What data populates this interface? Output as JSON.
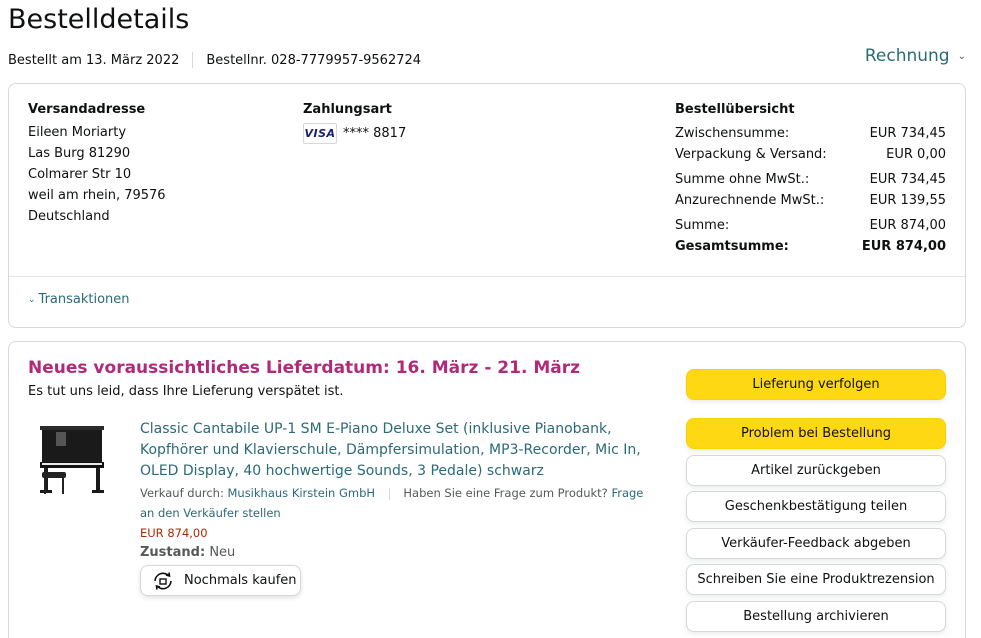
{
  "header": {
    "title": "Bestelldetails",
    "ordered_on": "Bestellt am 13. März 2022",
    "order_number": "Bestellnr. 028-7779957-9562724",
    "invoice_label": "Rechnung"
  },
  "shipping": {
    "title": "Versandadresse",
    "lines": [
      "Eileen Moriarty",
      "Las Burg 81290",
      "Colmarer Str 10",
      "weil am rhein, 79576",
      "Deutschland"
    ]
  },
  "payment": {
    "title": "Zahlungsart",
    "card_brand": "VISA",
    "card_number": "**** 8817"
  },
  "summary": {
    "title": "Bestellübersicht",
    "rows": [
      {
        "label": "Zwischensumme:",
        "value": "EUR 734,45"
      },
      {
        "label": "Verpackung & Versand:",
        "value": "EUR 0,00"
      },
      {
        "label": "Summe ohne MwSt.:",
        "value": "EUR 734,45"
      },
      {
        "label": "Anzurechnende MwSt.:",
        "value": "EUR 139,55"
      },
      {
        "label": "Summe:",
        "value": "EUR 874,00"
      },
      {
        "label": "Gesamtsumme:",
        "value": "EUR 874,00"
      }
    ]
  },
  "transactions_label": "Transaktionen",
  "shipment": {
    "delivery_title": "Neues voraussichtliches Lieferdatum: 16. März - 21. März",
    "delivery_subtitle": "Es tut uns leid, dass Ihre Lieferung verspätet ist.",
    "product_title": "Classic Cantabile UP-1 SM E-Piano Deluxe Set (inklusive Pianobank, Kopfhörer und Klavierschule, Dämpfersimulation, MP3-Recorder, Mic In, OLED Display, 40 hochwertige Sounds, 3 Pedale) schwarz",
    "sold_by_label": "Verkauf durch:",
    "seller_name": "Musikhaus Kirstein GmbH",
    "question_label": "Haben Sie eine Frage zum Produkt?",
    "question_link": "Frage an den Verkäufer stellen",
    "price": "EUR 874,00",
    "condition_label": "Zustand:",
    "condition_value": "Neu",
    "buy_again_label": "Nochmals kaufen"
  },
  "actions": {
    "track": "Lieferung verfolgen",
    "problem": "Problem bei Bestellung",
    "return": "Artikel zurückgeben",
    "gift": "Geschenkbestätigung teilen",
    "feedback": "Verkäufer-Feedback abgeben",
    "review": "Schreiben Sie eine Produktrezension",
    "archive": "Bestellung archivieren"
  },
  "colors": {
    "link": "#2b6a78",
    "delivery_title": "#b12a7a",
    "price": "#b12704",
    "primary_button": "#ffd814"
  },
  "icons": {
    "invoice_chevron": "chevron-down-icon",
    "transactions_chevron": "chevron-down-icon",
    "buy_again": "reorder-icon"
  }
}
